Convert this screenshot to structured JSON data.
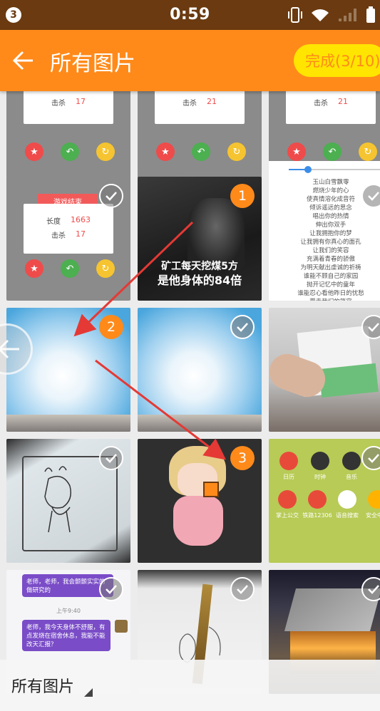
{
  "status_bar": {
    "notification_count": "3",
    "time": "0:59"
  },
  "app_bar": {
    "title": "所有图片",
    "done_label": "完成(3/10)"
  },
  "colors": {
    "accent": "#ff8a1a",
    "status_bar": "#6b3a10",
    "done_button": "#ffe500"
  },
  "tiles": {
    "row0": {
      "t0": {
        "kill_label": "击杀",
        "kill_value": "17"
      },
      "t1": {
        "kill_label": "击杀",
        "kill_value": "21"
      },
      "t2": {
        "kill_label": "击杀",
        "kill_value": "21"
      }
    },
    "row1": {
      "t0": {
        "game_over": "游戏结束",
        "length_label": "长度",
        "length_value": "1663",
        "kill_label": "击杀",
        "kill_value": "17"
      },
      "t1": {
        "badge": "1",
        "caption_line1": "矿工每天挖煤5方",
        "caption_line2": "是他身体的84倍"
      },
      "t2": {
        "lyrics": [
          "玉山白雪飘零",
          "燃烧少年的心",
          "使真情溶化成音符",
          "倾诉遥远的思念",
          "唱出你的热情",
          "伸出你双手",
          "让我拥抱你的梦",
          "让我拥有你真心的面孔",
          "让我们的笑容",
          "充满着青春的骄傲",
          "为明天献出虔诚的祈祷",
          "谁能不顾自己的家园",
          "抛开记忆中的童年",
          "谁能忍心看他昨日的忧愁",
          "带走我们的笑容"
        ]
      }
    },
    "row2": {
      "t0": {
        "badge": "2"
      }
    },
    "row3": {
      "t1": {
        "badge": "3"
      },
      "t2": {
        "apps": [
          "日历",
          "时钟",
          "音乐",
          "掌上公交",
          "铁路12306",
          "语音搜索",
          "安全中心"
        ]
      }
    },
    "row4": {
      "t0": {
        "chat1": "老师，老师，我会颤颤实实的做研究的",
        "time": "上午9:40",
        "chat2": "老师，我今天身体不舒服，有点发烧在宿舍休息，我能不能改天汇报？"
      }
    }
  },
  "game_buttons": {
    "restart": "重来",
    "back": "返回",
    "share": "分享"
  },
  "bottom_bar": {
    "album_label": "所有图片"
  }
}
